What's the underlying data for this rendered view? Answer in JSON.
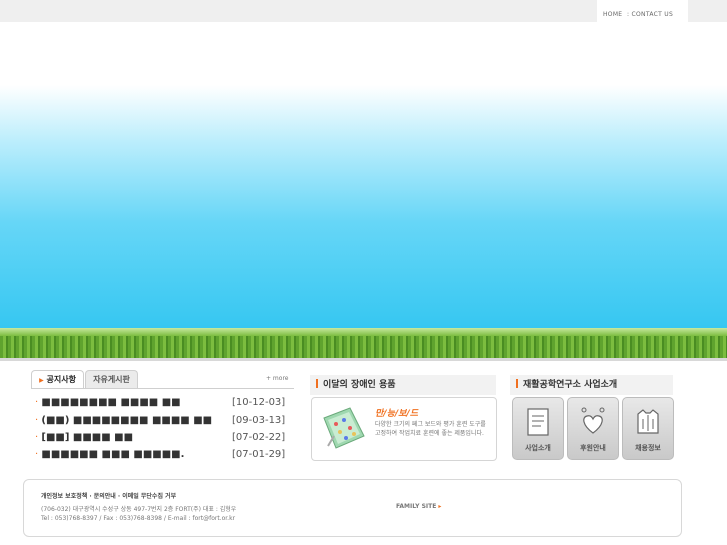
{
  "topnav": {
    "home": "HOME",
    "contact": ": CONTACT US"
  },
  "notice": {
    "tabs": [
      "공지사항",
      "자유게시판"
    ],
    "more": "+ more",
    "items": [
      {
        "title": "■■■■■■■■ ■■■■ ■■",
        "date": "[10-12-03]"
      },
      {
        "title": "(■■) ■■■■■■■■ ■■■■ ■■",
        "date": "[09-03-13]"
      },
      {
        "title": "[■■] ■■■■ ■■",
        "date": "[07-02-22]"
      },
      {
        "title": "■■■■■■ ■■■ ■■■■■.",
        "date": "[07-01-29]"
      }
    ]
  },
  "product": {
    "title": "이달의 장애인 용품",
    "name": "만/능/보/드",
    "desc": "다양한 크기의 페그 보드와 평가 훈련 도구를 고정하여 작업치료 훈련에 좋는 제품입니다."
  },
  "research": {
    "title": "재활공학연구소 사업소개",
    "buttons": [
      "사업소개",
      "후원안내",
      "채용정보"
    ]
  },
  "footer": {
    "links": "개인정보 보호정책 · 문의안내 · 이메일 무단수집 거부",
    "address": "(706-032) 대구광역시 수성구 상동 497-7번지 2층 FORT(주) 대표 : 김형우",
    "tel": "Tel : 053)768-8397 / Fax : 053)768-8398 / E-mail : fort@fort.or.kr",
    "family": "FAMILY SITE"
  }
}
